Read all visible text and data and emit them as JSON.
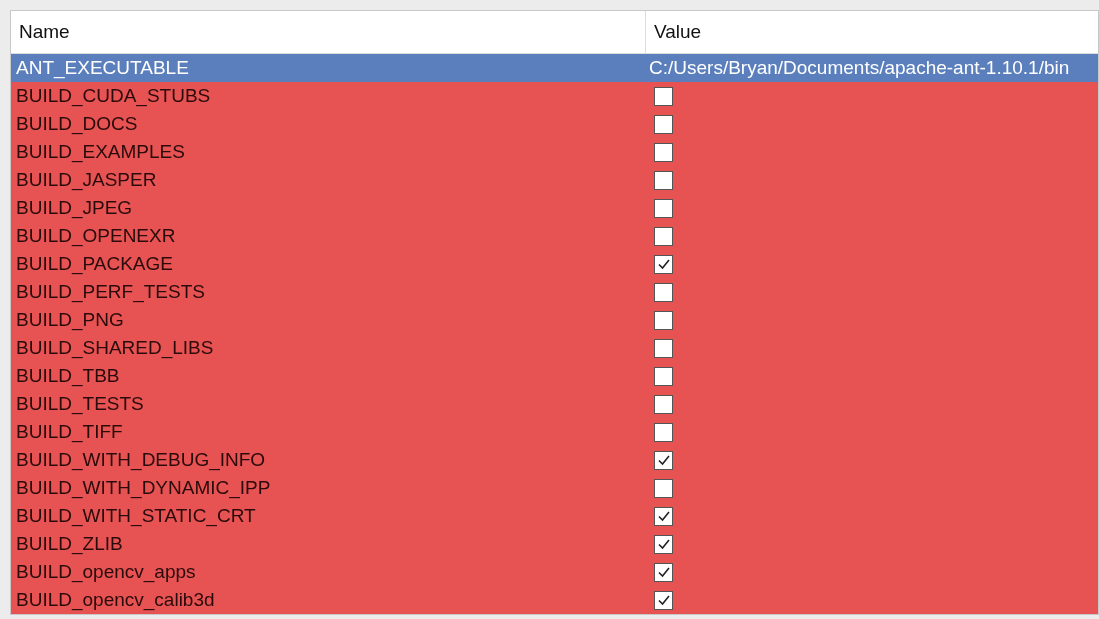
{
  "table": {
    "columns": [
      "Name",
      "Value"
    ],
    "rows": [
      {
        "name": "ANT_EXECUTABLE",
        "kind": "path",
        "value": "C:/Users/Bryan/Documents/apache-ant-1.10.1/bin",
        "selected": true
      },
      {
        "name": "BUILD_CUDA_STUBS",
        "kind": "bool",
        "checked": false,
        "selected": false
      },
      {
        "name": "BUILD_DOCS",
        "kind": "bool",
        "checked": false,
        "selected": false
      },
      {
        "name": "BUILD_EXAMPLES",
        "kind": "bool",
        "checked": false,
        "selected": false
      },
      {
        "name": "BUILD_JASPER",
        "kind": "bool",
        "checked": false,
        "selected": false
      },
      {
        "name": "BUILD_JPEG",
        "kind": "bool",
        "checked": false,
        "selected": false
      },
      {
        "name": "BUILD_OPENEXR",
        "kind": "bool",
        "checked": false,
        "selected": false
      },
      {
        "name": "BUILD_PACKAGE",
        "kind": "bool",
        "checked": true,
        "selected": false
      },
      {
        "name": "BUILD_PERF_TESTS",
        "kind": "bool",
        "checked": false,
        "selected": false
      },
      {
        "name": "BUILD_PNG",
        "kind": "bool",
        "checked": false,
        "selected": false
      },
      {
        "name": "BUILD_SHARED_LIBS",
        "kind": "bool",
        "checked": false,
        "selected": false
      },
      {
        "name": "BUILD_TBB",
        "kind": "bool",
        "checked": false,
        "selected": false
      },
      {
        "name": "BUILD_TESTS",
        "kind": "bool",
        "checked": false,
        "selected": false
      },
      {
        "name": "BUILD_TIFF",
        "kind": "bool",
        "checked": false,
        "selected": false
      },
      {
        "name": "BUILD_WITH_DEBUG_INFO",
        "kind": "bool",
        "checked": true,
        "selected": false
      },
      {
        "name": "BUILD_WITH_DYNAMIC_IPP",
        "kind": "bool",
        "checked": false,
        "selected": false
      },
      {
        "name": "BUILD_WITH_STATIC_CRT",
        "kind": "bool",
        "checked": true,
        "selected": false
      },
      {
        "name": "BUILD_ZLIB",
        "kind": "bool",
        "checked": true,
        "selected": false
      },
      {
        "name": "BUILD_opencv_apps",
        "kind": "bool",
        "checked": true,
        "selected": false
      },
      {
        "name": "BUILD_opencv_calib3d",
        "kind": "bool",
        "checked": true,
        "selected": false
      }
    ]
  }
}
